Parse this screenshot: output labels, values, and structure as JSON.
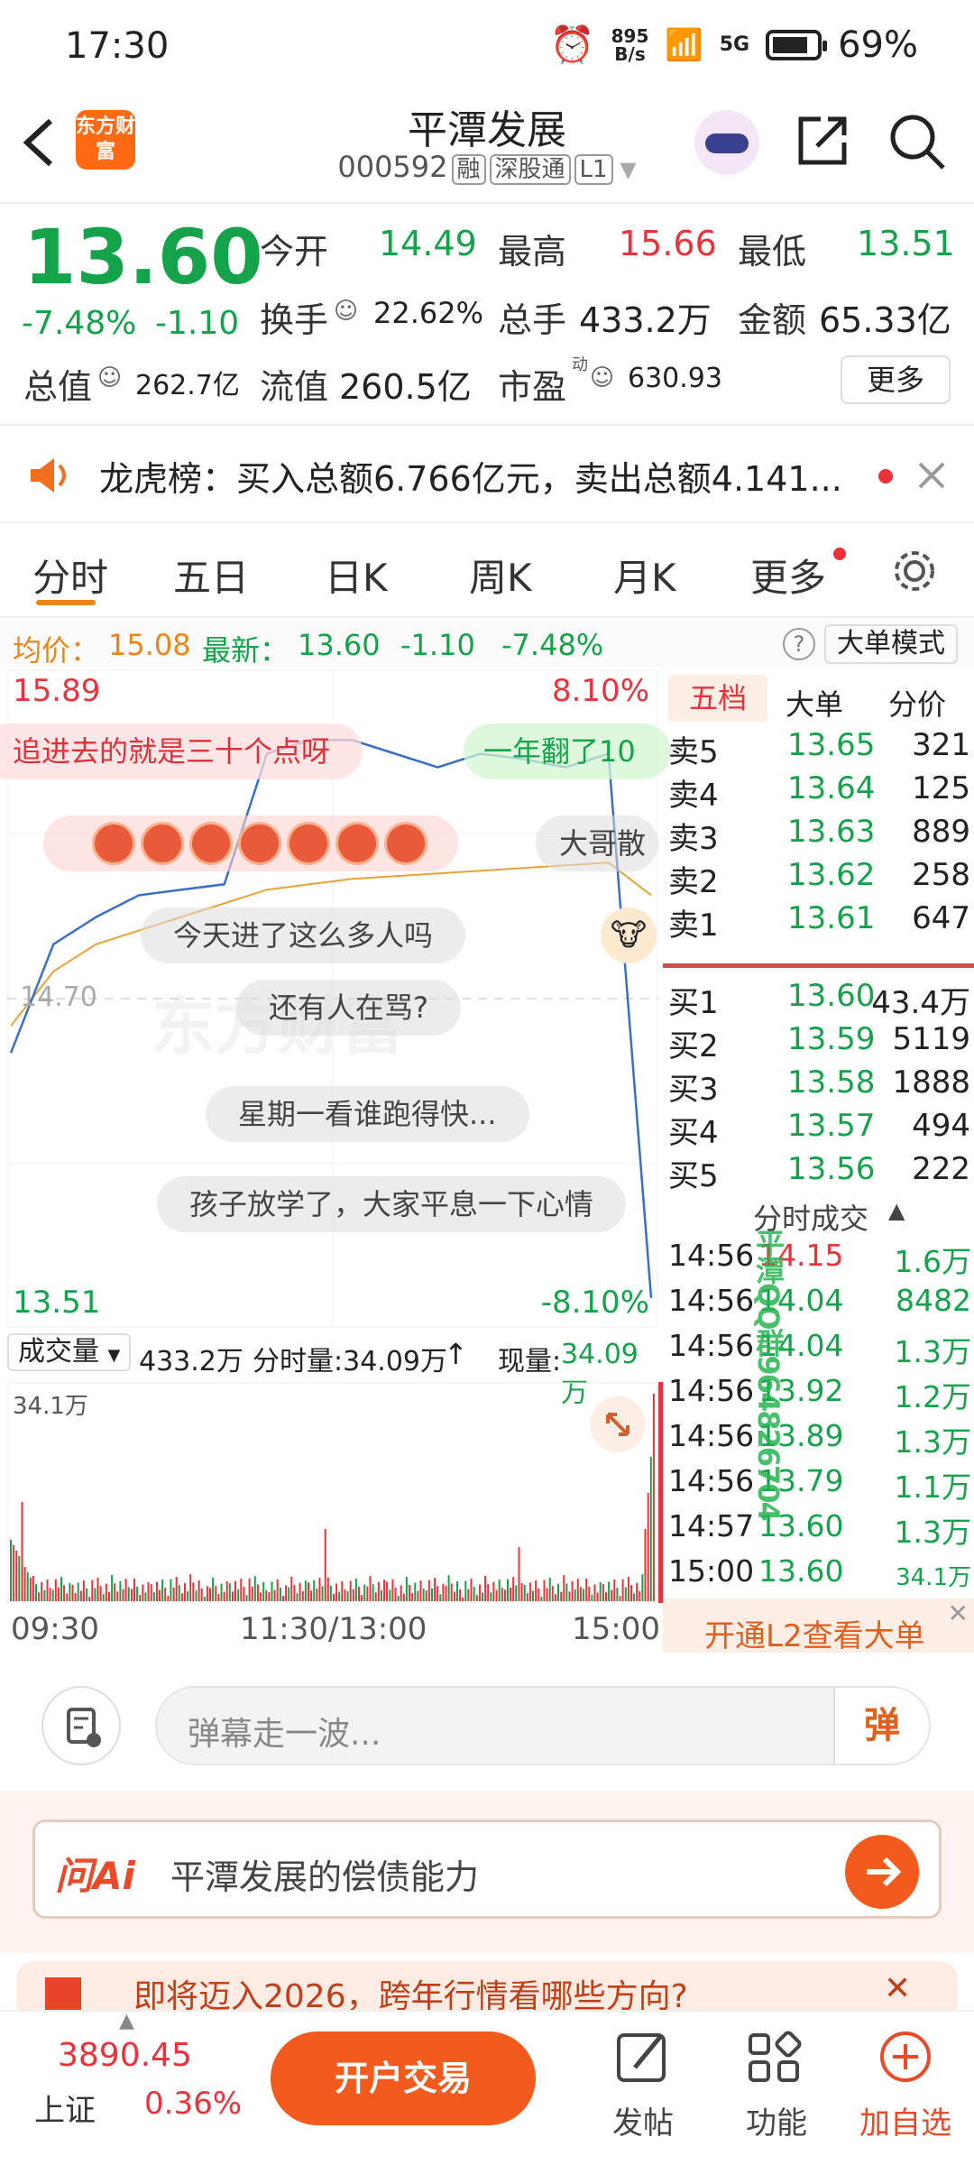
{
  "status": {
    "time": "17:30",
    "net_speed_top": "895",
    "net_speed_bottom": "B/s",
    "signal": "5G",
    "battery": "69%"
  },
  "header": {
    "title": "平潭发展",
    "code": "000592",
    "tags": [
      "融",
      "深股通",
      "L1"
    ],
    "logo_text": "东方财富"
  },
  "quote": {
    "price": "13.60",
    "change_pct": "-7.48%",
    "change": "-1.10",
    "open_label": "今开",
    "open": "14.49",
    "high_label": "最高",
    "high": "15.66",
    "low_label": "最低",
    "low": "13.51",
    "turnover_label": "换手",
    "turnover": "22.62%",
    "volume_label": "总手",
    "volume": "433.2万",
    "amount_label": "金额",
    "amount": "65.33亿",
    "mktcap_label": "总值",
    "mktcap": "262.7亿",
    "float_label": "流值",
    "float": "260.5亿",
    "pe_label": "市盈",
    "pe_sup": "动",
    "pe": "630.93",
    "more": "更多"
  },
  "news": {
    "text": "龙虎榜：买入总额6.766亿元，卖出总额4.141..."
  },
  "tabs": [
    "分时",
    "五日",
    "日K",
    "周K",
    "月K",
    "更多"
  ],
  "avg": {
    "avg_label": "均价：",
    "avg": "15.08",
    "latest_label": "最新：",
    "latest": "13.60",
    "chg": "-1.10",
    "pct": "-7.48%",
    "mode": "大单模式"
  },
  "chart": {
    "top_price": "15.89",
    "top_pct": "8.10%",
    "bottom_price": "13.51",
    "bottom_pct": "-8.10%",
    "mid_price": "14.70",
    "watermark": "东方财富"
  },
  "chart_data": {
    "type": "line",
    "title": "",
    "ylim": [
      13.51,
      15.89
    ],
    "reference": 14.7,
    "x": [
      "09:30",
      "11:30/13:00",
      "15:00"
    ],
    "series": [
      {
        "name": "",
        "values": [
          14.5,
          14.9,
          15.0,
          15.08,
          15.1,
          15.12,
          15.6,
          15.65,
          15.65,
          15.6,
          15.55,
          15.6,
          15.58,
          15.55,
          15.6,
          13.6
        ]
      },
      {
        "name": "",
        "values": [
          14.6,
          14.8,
          14.9,
          14.95,
          15.0,
          15.05,
          15.1,
          15.12,
          15.14,
          15.15,
          15.16,
          15.17,
          15.18,
          15.19,
          15.2,
          15.08
        ]
      }
    ]
  },
  "danmu": [
    "追进去的就是三十个点呀",
    "一年翻了10",
    "大哥散",
    "今天进了这么多人吗",
    "还有人在骂?",
    "星期一看谁跑得快...",
    "孩子放学了，大家平息一下心情"
  ],
  "orderbook": {
    "tabs": [
      "五档",
      "大单",
      "分价"
    ],
    "asks": [
      {
        "label": "卖5",
        "price": "13.65",
        "qty": "321"
      },
      {
        "label": "卖4",
        "price": "13.64",
        "qty": "125"
      },
      {
        "label": "卖3",
        "price": "13.63",
        "qty": "889"
      },
      {
        "label": "卖2",
        "price": "13.62",
        "qty": "258"
      },
      {
        "label": "卖1",
        "price": "13.61",
        "qty": "647"
      }
    ],
    "bids": [
      {
        "label": "买1",
        "price": "13.60",
        "qty": "43.4万"
      },
      {
        "label": "买2",
        "price": "13.59",
        "qty": "5119"
      },
      {
        "label": "买3",
        "price": "13.58",
        "qty": "1888"
      },
      {
        "label": "买4",
        "price": "13.57",
        "qty": "494"
      },
      {
        "label": "买5",
        "price": "13.56",
        "qty": "222"
      }
    ]
  },
  "ticks": {
    "title": "分时成交",
    "rows": [
      {
        "time": "14:56",
        "price": "14.15",
        "qty": "1.6万"
      },
      {
        "time": "14:56",
        "price": "14.04",
        "qty": "8482"
      },
      {
        "time": "14:56",
        "price": "14.04",
        "qty": "1.3万"
      },
      {
        "time": "14:56",
        "price": "13.92",
        "qty": "1.2万"
      },
      {
        "time": "14:56",
        "price": "13.89",
        "qty": "1.3万"
      },
      {
        "time": "14:56",
        "price": "13.79",
        "qty": "1.1万"
      },
      {
        "time": "14:57",
        "price": "13.60",
        "qty": "1.3万"
      },
      {
        "time": "15:00",
        "price": "13.60",
        "qty": "34.1万"
      }
    ],
    "l2": "开通L2查看大单",
    "watermark": "平潭QQ群964826704"
  },
  "volume": {
    "label": "成交量",
    "total": "433.2万",
    "period": "分时量:34.09万",
    "now_label": "现量:",
    "now": "34.09万",
    "max": "34.1万"
  },
  "time_axis": [
    "09:30",
    "11:30/13:00",
    "15:00"
  ],
  "danmu_input": {
    "placeholder": "弹幕走一波...",
    "send": "弹"
  },
  "ai": {
    "logo": "问Ai",
    "text": "平潭发展的偿债能力"
  },
  "banner": {
    "text": "即将迈入2026，跨年行情看哪些方向?"
  },
  "bottom": {
    "index_value": "3890.45",
    "index_name": "上证",
    "index_pct": "0.36%",
    "trade": "开户交易",
    "post": "发帖",
    "func": "功能",
    "add": "加自选"
  }
}
